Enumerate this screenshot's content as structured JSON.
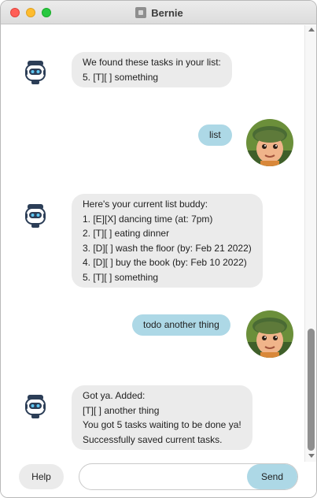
{
  "window": {
    "title": "Bernie"
  },
  "messages": [
    {
      "sender": "bot",
      "text": "We found these tasks in your list:\n5. [T][ ] something"
    },
    {
      "sender": "user",
      "text": "list"
    },
    {
      "sender": "bot",
      "text": "Here's your current list buddy:\n1. [E][X] dancing time (at: 7pm)\n2. [T][ ] eating dinner\n3. [D][ ] wash the floor (by: Feb 21 2022)\n4. [D][ ] buy the book (by: Feb 10 2022)\n5. [T][ ] something"
    },
    {
      "sender": "user",
      "text": "todo another thing"
    },
    {
      "sender": "bot",
      "text": "Got ya. Added:\n[T][ ] another thing\nYou got 5 tasks waiting to be done ya!\nSuccessfully saved current tasks."
    }
  ],
  "input": {
    "value": "",
    "placeholder": ""
  },
  "buttons": {
    "help": "Help",
    "send": "Send"
  },
  "icons": {
    "bot_avatar": "robot-icon",
    "user_avatar": "boy-scout-avatar"
  },
  "colors": {
    "user_bubble": "#add8e6",
    "bot_bubble": "#ebebeb",
    "send_button": "#add8e6"
  }
}
